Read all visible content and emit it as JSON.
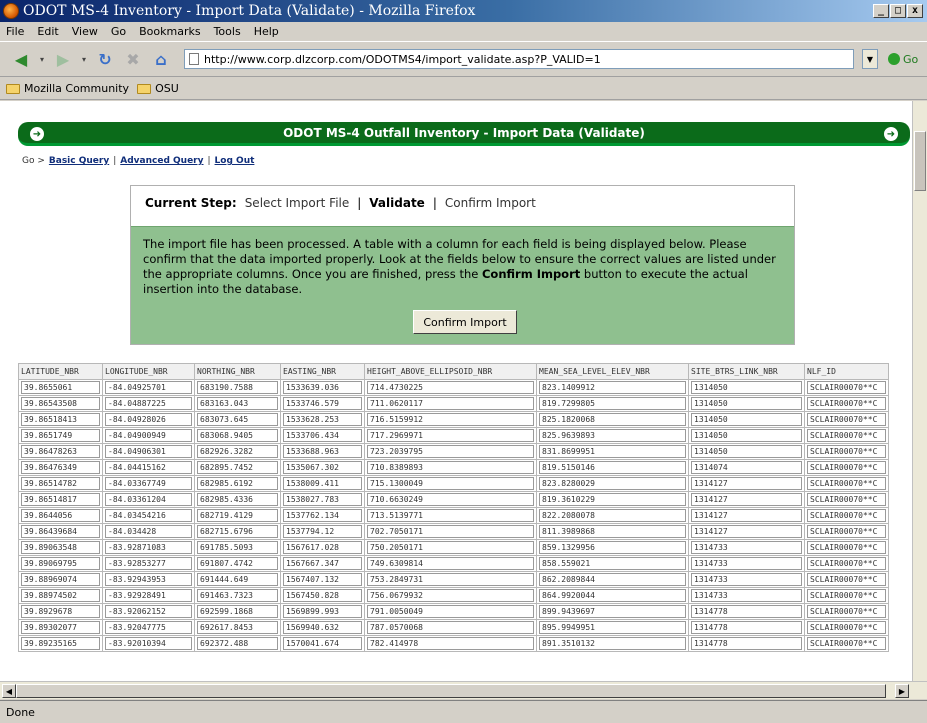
{
  "window": {
    "title": "ODOT MS-4 Inventory - Import Data (Validate) - Mozilla Firefox",
    "min": "_",
    "max": "□",
    "close": "x"
  },
  "menu": [
    "File",
    "Edit",
    "View",
    "Go",
    "Bookmarks",
    "Tools",
    "Help"
  ],
  "nav": {
    "url": "http://www.corp.dlzcorp.com/ODOTMS4/import_validate.asp?P_VALID=1",
    "go_label": "Go"
  },
  "bookmarks": [
    "Mozilla Community",
    "OSU"
  ],
  "page": {
    "header_title": "ODOT MS-4 Outfall Inventory - Import Data (Validate)",
    "go_label": "Go >",
    "links": [
      "Basic Query",
      "Advanced Query",
      "Log Out"
    ],
    "current_step_label": "Current Step:",
    "steps": [
      "Select Import File",
      "Validate",
      "Confirm Import"
    ],
    "message_part1": "The import file has been processed. A table with a column for each field is being displayed below. Please confirm that the data imported properly. Look at the fields below to ensure the correct values are listed under the appropriate columns. Once you are finished, press the ",
    "message_bold": "Confirm Import",
    "message_part2": " button to execute the actual insertion into the database.",
    "confirm_button": "Confirm Import"
  },
  "table": {
    "columns": [
      "LATITUDE_NBR",
      "LONGITUDE_NBR",
      "NORTHING_NBR",
      "EASTING_NBR",
      "HEIGHT_ABOVE_ELLIPSOID_NBR",
      "MEAN_SEA_LEVEL_ELEV_NBR",
      "SITE_BTRS_LINK_NBR",
      "NLF_ID"
    ],
    "rows": [
      [
        "39.8655061",
        "-84.04925701",
        "683190.7588",
        "1533639.036",
        "714.4730225",
        "823.1409912",
        "1314050",
        "SCLAIR00070**C"
      ],
      [
        "39.86543508",
        "-84.04887225",
        "683163.043",
        "1533746.579",
        "711.0620117",
        "819.7299805",
        "1314050",
        "SCLAIR00070**C"
      ],
      [
        "39.86518413",
        "-84.04928026",
        "683073.645",
        "1533628.253",
        "716.5159912",
        "825.1820068",
        "1314050",
        "SCLAIR00070**C"
      ],
      [
        "39.8651749",
        "-84.04900949",
        "683068.9405",
        "1533706.434",
        "717.2969971",
        "825.9639893",
        "1314050",
        "SCLAIR00070**C"
      ],
      [
        "39.86478263",
        "-84.04906301",
        "682926.3282",
        "1533688.963",
        "723.2039795",
        "831.8699951",
        "1314050",
        "SCLAIR00070**C"
      ],
      [
        "39.86476349",
        "-84.04415162",
        "682895.7452",
        "1535067.302",
        "710.8389893",
        "819.5150146",
        "1314074",
        "SCLAIR00070**C"
      ],
      [
        "39.86514782",
        "-84.03367749",
        "682985.6192",
        "1538009.411",
        "715.1300049",
        "823.8280029",
        "1314127",
        "SCLAIR00070**C"
      ],
      [
        "39.86514817",
        "-84.03361204",
        "682985.4336",
        "1538027.783",
        "710.6630249",
        "819.3610229",
        "1314127",
        "SCLAIR00070**C"
      ],
      [
        "39.8644056",
        "-84.03454216",
        "682719.4129",
        "1537762.134",
        "713.5139771",
        "822.2080078",
        "1314127",
        "SCLAIR00070**C"
      ],
      [
        "39.86439684",
        "-84.034428",
        "682715.6796",
        "1537794.12",
        "702.7050171",
        "811.3989868",
        "1314127",
        "SCLAIR00070**C"
      ],
      [
        "39.89063548",
        "-83.92871083",
        "691785.5093",
        "1567617.028",
        "750.2050171",
        "859.1329956",
        "1314733",
        "SCLAIR00070**C"
      ],
      [
        "39.89069795",
        "-83.92853277",
        "691807.4742",
        "1567667.347",
        "749.6309814",
        "858.559021",
        "1314733",
        "SCLAIR00070**C"
      ],
      [
        "39.88969074",
        "-83.92943953",
        "691444.649",
        "1567407.132",
        "753.2849731",
        "862.2089844",
        "1314733",
        "SCLAIR00070**C"
      ],
      [
        "39.88974502",
        "-83.92928491",
        "691463.7323",
        "1567450.828",
        "756.0679932",
        "864.9920044",
        "1314733",
        "SCLAIR00070**C"
      ],
      [
        "39.8929678",
        "-83.92062152",
        "692599.1868",
        "1569899.993",
        "791.0050049",
        "899.9439697",
        "1314778",
        "SCLAIR00070**C"
      ],
      [
        "39.89302077",
        "-83.92047775",
        "692617.8453",
        "1569940.632",
        "787.0570068",
        "895.9949951",
        "1314778",
        "SCLAIR00070**C"
      ],
      [
        "39.89235165",
        "-83.92010394",
        "692372.488",
        "1570041.674",
        "782.414978",
        "891.3510132",
        "1314778",
        "SCLAIR00070**C"
      ]
    ]
  },
  "status": "Done"
}
